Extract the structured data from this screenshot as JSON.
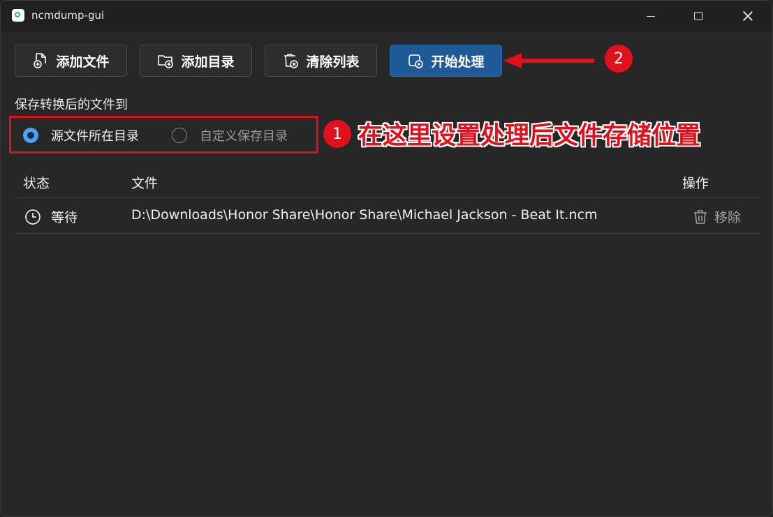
{
  "window": {
    "title": "ncmdump-gui"
  },
  "toolbar": {
    "add_file": "添加文件",
    "add_folder": "添加目录",
    "clear_list": "清除列表",
    "start": "开始处理"
  },
  "save": {
    "label": "保存转换后的文件到",
    "options": [
      {
        "label": "源文件所在目录",
        "selected": true
      },
      {
        "label": "自定义保存目录",
        "selected": false
      }
    ]
  },
  "table": {
    "headers": [
      "状态",
      "文件",
      "操作"
    ],
    "rows": [
      {
        "status": "等待",
        "file": "D:\\Downloads\\Honor Share\\Honor Share\\Michael Jackson - Beat It.ncm",
        "action": "移除"
      }
    ]
  },
  "annotations": {
    "badge1": "1",
    "badge2": "2",
    "text": "在这里设置处理后文件存储位置"
  },
  "colors": {
    "accent": "#1f5a97",
    "annotation_red": "#e0111c",
    "radio_selected": "#4aa3f5"
  }
}
